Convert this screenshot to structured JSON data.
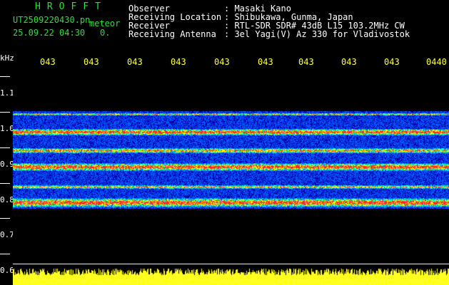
{
  "header": {
    "brand": "HROFFT",
    "file_name": "UT2509220430.pn",
    "meteor_label": "meteor",
    "timestamp": "25.09.22 04:30",
    "meteor_count": "0.",
    "info": [
      {
        "label": "Observer",
        "value": ": Masaki Kano"
      },
      {
        "label": "Receiving Location",
        "value": ": Shibukawa, Gunma, Japan"
      },
      {
        "label": "Receiver",
        "value": ": RTL-SDR SDR# 43dB L15 103.2MHz CW"
      },
      {
        "label": "Receiving Antenna",
        "value": ": 3el Yagi(V) Az 330 for Vladivostok"
      }
    ]
  },
  "axis": {
    "y_unit": "kHz",
    "y_ticks": [
      "1.1",
      "1.0",
      "0.9",
      "0.8",
      "0.7",
      "0.6"
    ],
    "x_ticks": [
      "043",
      "043",
      "043",
      "043",
      "043",
      "043",
      "043",
      "043",
      "043",
      "0440"
    ]
  },
  "colors": {
    "text_green": "#2fe03a",
    "text_white": "#ffffff",
    "tick_yellow": "#ffff40",
    "background": "#000000"
  }
}
